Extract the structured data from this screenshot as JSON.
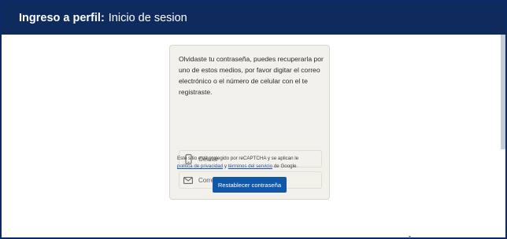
{
  "header": {
    "title_bold": "Ingreso a perfil:",
    "title_rest": "Inicio de sesion"
  },
  "card": {
    "intro": "Olvidaste tu contraseña, puedes recuperarla por uno de estos medios, por favor digitar el correo electrónico o el número de celular con el te registraste.",
    "phone_option": {
      "label": "Celular",
      "icon": "phone-icon"
    },
    "email_option": {
      "label": "Correo electrónico",
      "icon": "envelope-icon"
    },
    "recaptcha": {
      "before": "Este sitio está protegido por reCAPTCHA y se aplican le",
      "privacy_link": "política de privacidad",
      "middle": "y",
      "terms_link": "términos del servicio",
      "after": "de Google."
    },
    "submit_label": "Restablecer contraseña"
  }
}
